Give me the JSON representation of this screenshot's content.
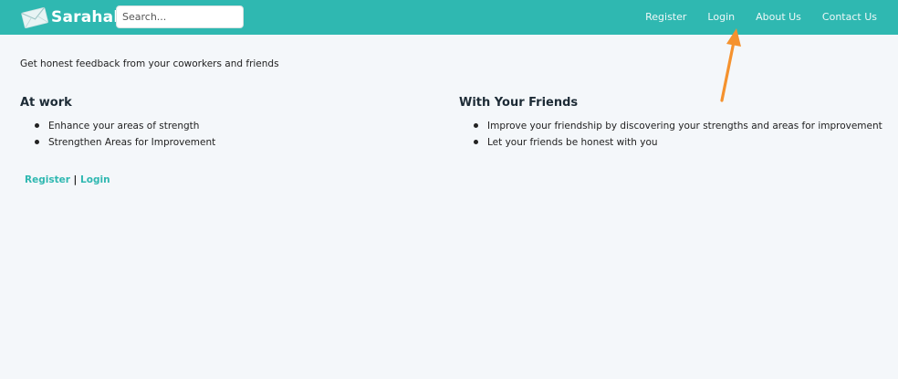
{
  "navbar": {
    "brand": "Sarahah",
    "brand_icon": "envelope-icon",
    "search_placeholder": "Search...",
    "links": [
      "Register",
      "Login",
      "About Us",
      "Contact Us"
    ],
    "accent_color": "#2fb8b1"
  },
  "main": {
    "tagline": "Get honest feedback from your coworkers and friends",
    "sections": [
      {
        "title": "At work",
        "items": [
          "Enhance your areas of strength",
          "Strengthen Areas for Improvement"
        ]
      },
      {
        "title": "With Your Friends",
        "items": [
          "Improve your friendship by discovering your strengths and areas for improvement",
          "Let your friends be honest with you"
        ]
      }
    ],
    "footer_links": {
      "register": "Register",
      "separator": "|",
      "login": "Login"
    }
  },
  "annotation": {
    "arrow_color": "#f5922e",
    "arrow_icon": "arrow-up-icon"
  }
}
